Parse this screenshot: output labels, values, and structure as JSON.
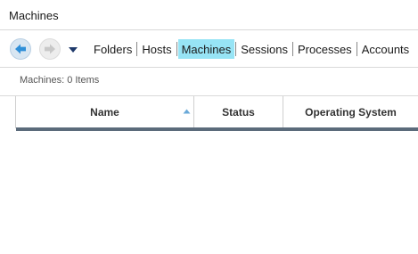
{
  "window": {
    "title": "Machines"
  },
  "nav": {
    "back_icon": "arrow-left-icon",
    "forward_icon": "arrow-right-icon",
    "dropdown_icon": "chevron-down-icon",
    "breadcrumbs": [
      {
        "label": "Folders",
        "active": false
      },
      {
        "label": "Hosts",
        "active": false
      },
      {
        "label": "Machines",
        "active": true
      },
      {
        "label": "Sessions",
        "active": false
      },
      {
        "label": "Processes",
        "active": false
      },
      {
        "label": "Accounts",
        "active": false
      }
    ]
  },
  "grid": {
    "count_label": "Machines: 0 Items",
    "columns": [
      {
        "label": "Name",
        "sorted": "ascending"
      },
      {
        "label": "Status"
      },
      {
        "label": "Operating System"
      }
    ],
    "rows": []
  },
  "colors": {
    "active_crumb": "#97e4f5",
    "header_underline": "#5b6b7b",
    "back_button": "#d8e6f2"
  }
}
